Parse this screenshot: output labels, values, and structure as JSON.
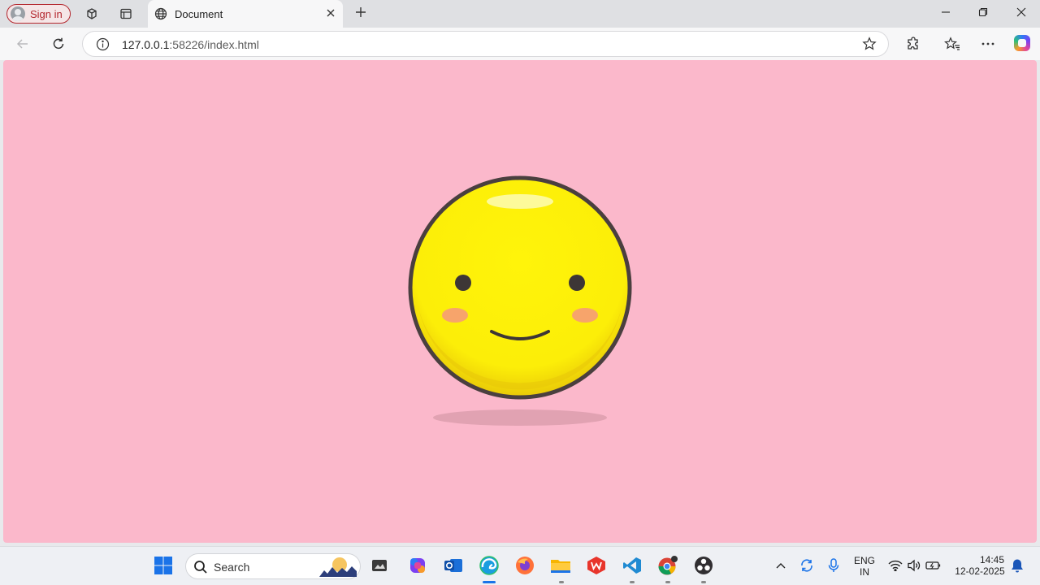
{
  "browser": {
    "signin_label": "Sign in",
    "tab_title": "Document",
    "url_host": "127.0.0.1",
    "url_rest": ":58226/index.html"
  },
  "page": {
    "background": "#fbb8cb",
    "face_color": "#fcf00c",
    "face_outline": "#4a3f3f",
    "cheek_color": "#f7a46b"
  },
  "taskbar": {
    "search_label": "Search",
    "language": "ENG",
    "region": "IN",
    "time": "14:45",
    "date": "12-02-2025"
  },
  "icons": [
    "user-icon",
    "workspaces-icon",
    "tab-actions-icon",
    "globe-icon",
    "close-icon",
    "new-tab-icon",
    "minimize-icon",
    "restore-icon",
    "window-close-icon",
    "back-icon",
    "refresh-icon",
    "info-icon",
    "favorite-star-icon",
    "extensions-icon",
    "favorites-icon",
    "more-icon",
    "copilot-icon",
    "windows-start-icon",
    "search-icon",
    "wifi-icon",
    "speaker-icon",
    "battery-icon",
    "notification-bell-icon"
  ]
}
